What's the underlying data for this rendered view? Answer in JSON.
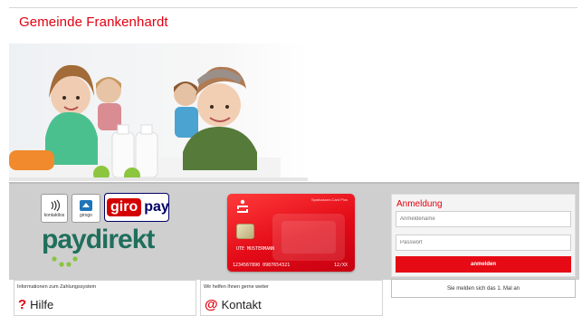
{
  "header": {
    "title": "Gemeinde Frankenhardt"
  },
  "hero": {
    "image": "children-with-milk-bottles-photo"
  },
  "payment": {
    "kontaktlos_label": "kontaktlos",
    "girogo_label": "girogo",
    "giropay": {
      "giro": "giro",
      "pay": "pay"
    },
    "paydirekt": {
      "pay": "pay",
      "direkt": "direkt"
    }
  },
  "card": {
    "brand": "Sparkassen-Card Plus",
    "name": "UTE MUSTERMANN",
    "number": "1234567890   0987654321",
    "expiry": "12/XX"
  },
  "login": {
    "title": "Anmeldung",
    "username_placeholder": "Anmeldename",
    "password_placeholder": "Passwort",
    "submit_label": "anmelden",
    "register_label": "Sie melden sich das 1. Mal an"
  },
  "info": [
    {
      "caption": "Informationen zum Zahlungssystem",
      "heading": "Hilfe",
      "icon": "question-icon"
    },
    {
      "caption": "Wir helfen Ihnen gerne weiter",
      "heading": "Kontakt",
      "icon": "at-icon"
    }
  ],
  "colors": {
    "accent": "#e3000f",
    "band": "#cfcfcf",
    "paydirekt": "#1f6f5c",
    "giropay_blue": "#000066"
  }
}
